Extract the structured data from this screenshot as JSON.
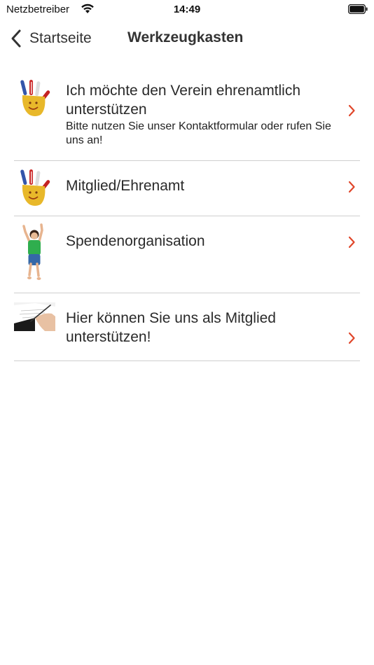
{
  "status_bar": {
    "carrier": "Netzbetreiber",
    "time": "14:49"
  },
  "nav": {
    "back_label": "Startseite",
    "title": "Werkzeugkasten"
  },
  "items": [
    {
      "title": " Ich möchte den Verein ehrenamtlich unterstützen",
      "subtitle": "Bitte nutzen Sie unser Kontaktformular oder rufen Sie uns an!",
      "icon": "painted-hand-image"
    },
    {
      "title": " Mitglied/Ehrenamt",
      "subtitle": "",
      "icon": "painted-hand-image"
    },
    {
      "title": " Spendenorganisation",
      "subtitle": "",
      "icon": "jumping-child-image"
    },
    {
      "title": " Hier können Sie uns als Mitglied unterstützen!",
      "subtitle": "",
      "icon": "writing-hand-image"
    }
  ],
  "colors": {
    "accent": "#e0462a",
    "divider": "#cfcfcf",
    "text": "#2a2a2a"
  }
}
